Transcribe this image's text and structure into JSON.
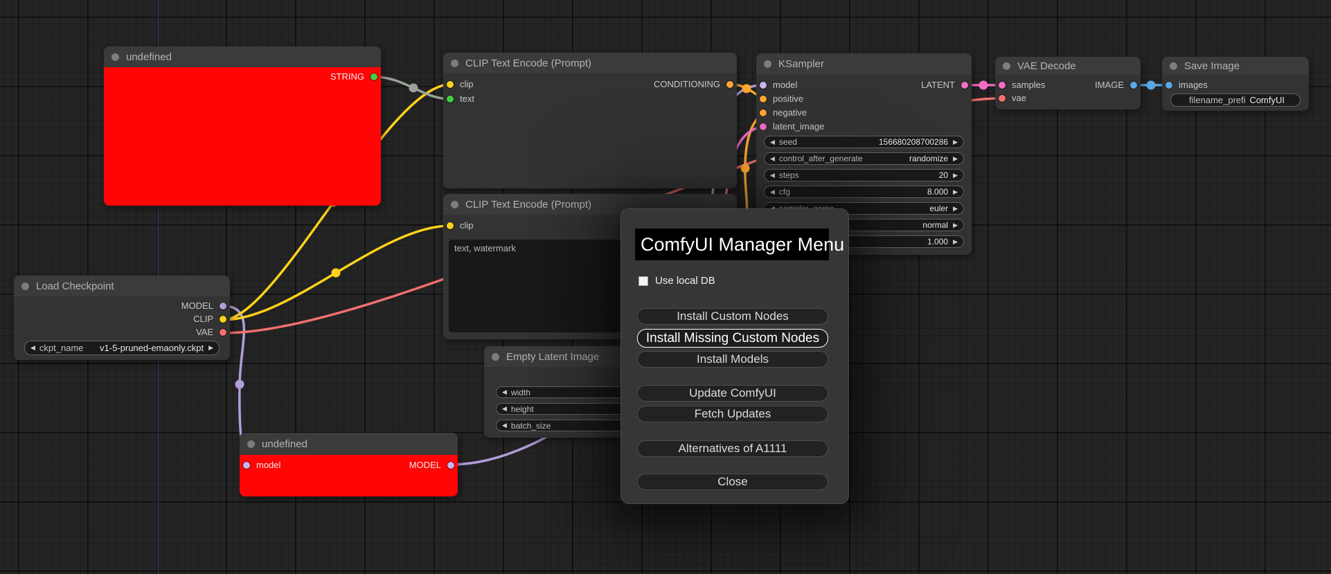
{
  "canvas": {
    "background": "#242424"
  },
  "link_colors": {
    "model": "#b39ddb",
    "clip": "#ffd21c",
    "vae": "#f26f6f",
    "conditioning": "#ffa931",
    "latent": "#f06ec5",
    "image": "#5aa8e8",
    "string_wire": "#9aa299",
    "string_slot": "#3fd13f"
  },
  "icons": {
    "arrow_left": "◀",
    "arrow_right": "▶"
  },
  "nodes": {
    "undefined_top": {
      "title": "undefined",
      "output": "STRING"
    },
    "clip_encode_1": {
      "title": "CLIP Text Encode (Prompt)",
      "input_clip": "clip",
      "input_text": "text",
      "output": "CONDITIONING"
    },
    "clip_encode_2": {
      "title": "CLIP Text Encode (Prompt)",
      "input_clip": "clip",
      "text_value": "text, watermark"
    },
    "empty_latent": {
      "title": "Empty Latent Image",
      "widgets": [
        {
          "label": "width"
        },
        {
          "label": "height"
        },
        {
          "label": "batch_size"
        }
      ]
    },
    "undefined_bottom": {
      "title": "undefined",
      "input": "model",
      "output": "MODEL"
    },
    "load_checkpoint": {
      "title": "Load Checkpoint",
      "outputs": [
        "MODEL",
        "CLIP",
        "VAE"
      ],
      "widget": {
        "label": "ckpt_name",
        "value": "v1-5-pruned-emaonly.ckpt"
      }
    },
    "ksampler": {
      "title": "KSampler",
      "inputs": [
        "model",
        "positive",
        "negative",
        "latent_image"
      ],
      "output": "LATENT",
      "widgets": [
        {
          "label": "seed",
          "value": "156680208700286"
        },
        {
          "label": "control_after_generate",
          "value": "randomize"
        },
        {
          "label": "steps",
          "value": "20"
        },
        {
          "label": "cfg",
          "value": "8.000"
        },
        {
          "label": "sampler_name",
          "value": "euler"
        },
        {
          "label": "",
          "value": "normal"
        },
        {
          "label": "",
          "value": "1.000"
        }
      ]
    },
    "vae_decode": {
      "title": "VAE Decode",
      "inputs": [
        "samples",
        "vae"
      ],
      "output": "IMAGE"
    },
    "save_image": {
      "title": "Save Image",
      "input": "images",
      "widget": {
        "label": "filename_prefix",
        "value": "ComfyUI"
      }
    }
  },
  "manager_menu": {
    "title": "ComfyUI Manager Menu",
    "checkbox_label": "Use local DB",
    "checkbox_checked": false,
    "buttons": [
      {
        "label": "Install Custom Nodes"
      },
      {
        "label": "Install Missing Custom Nodes",
        "highlighted": true
      },
      {
        "label": "Install Models"
      },
      {
        "label": "Update ComfyUI"
      },
      {
        "label": "Fetch Updates"
      },
      {
        "label": "Alternatives of A1111"
      },
      {
        "label": "Close"
      }
    ]
  }
}
